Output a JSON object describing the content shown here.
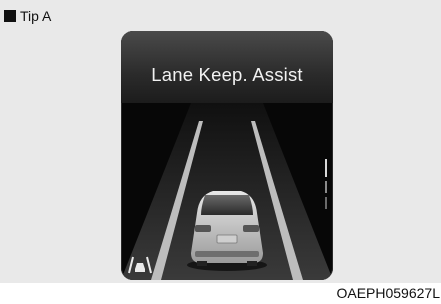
{
  "tip_label": "Tip A",
  "display": {
    "message": "Lane Keep. Assist",
    "lka_icon": "lane-keeping-assist-icon",
    "scene": "car-driving-between-lane-lines"
  },
  "figure_code": "OAEPH059627L",
  "colors": {
    "panel_bg": "#e9e9e9",
    "display_bg": "#070707",
    "header_gradient_top": "#4a4a4a",
    "header_gradient_bottom": "#1c1c1c",
    "message_text": "#f2f2f2"
  }
}
